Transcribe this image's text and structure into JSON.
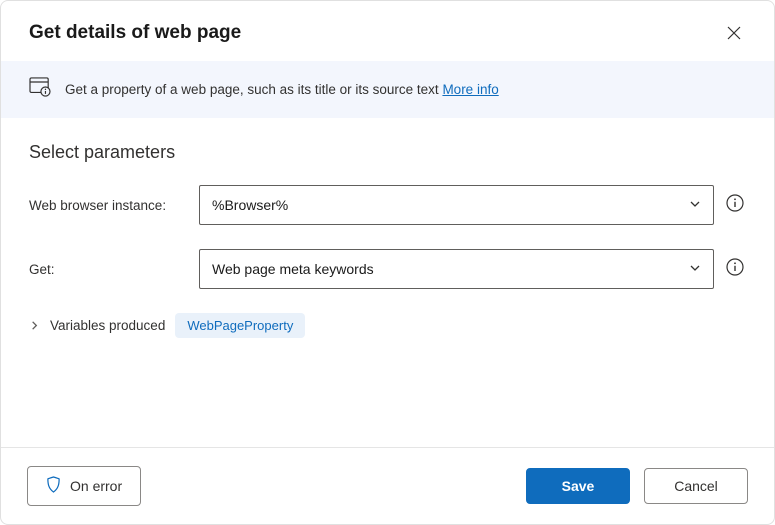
{
  "header": {
    "title": "Get details of web page"
  },
  "banner": {
    "text": "Get a property of a web page, such as its title or its source text ",
    "link_label": "More info"
  },
  "section": {
    "title": "Select parameters"
  },
  "params": {
    "browser_label": "Web browser instance:",
    "browser_value": "%Browser%",
    "get_label": "Get:",
    "get_value": "Web page meta keywords"
  },
  "vars": {
    "label": "Variables produced",
    "produced": "WebPageProperty"
  },
  "footer": {
    "on_error": "On error",
    "save": "Save",
    "cancel": "Cancel"
  }
}
